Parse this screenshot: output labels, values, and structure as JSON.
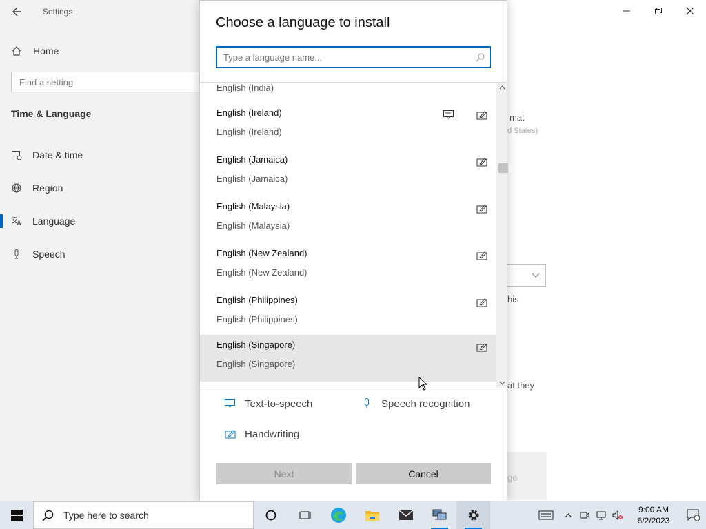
{
  "settings": {
    "app_title": "Settings",
    "home_label": "Home",
    "find_placeholder": "Find a setting",
    "section_title": "Time & Language",
    "nav": [
      {
        "label": "Date & time",
        "icon": "calendar-clock-icon"
      },
      {
        "label": "Region",
        "icon": "globe-icon"
      },
      {
        "label": "Language",
        "icon": "language-icon"
      },
      {
        "label": "Speech",
        "icon": "microphone-icon"
      }
    ],
    "active_nav": "Language",
    "background_fragments": {
      "format": "mat",
      "united_states": "d States)",
      "this": "his",
      "that_they": "at they",
      "ge": "ge"
    }
  },
  "dialog": {
    "title": "Choose a language to install",
    "search_placeholder": "Type a language name...",
    "partial_item": "English (India)",
    "languages": [
      {
        "name": "English (Ireland)",
        "native": "English (Ireland)",
        "tts": true,
        "handwriting": true,
        "selected": false
      },
      {
        "name": "English (Jamaica)",
        "native": "English (Jamaica)",
        "tts": false,
        "handwriting": true,
        "selected": false
      },
      {
        "name": "English (Malaysia)",
        "native": "English (Malaysia)",
        "tts": false,
        "handwriting": true,
        "selected": false
      },
      {
        "name": "English (New Zealand)",
        "native": "English (New Zealand)",
        "tts": false,
        "handwriting": true,
        "selected": false
      },
      {
        "name": "English (Philippines)",
        "native": "English (Philippines)",
        "tts": false,
        "handwriting": true,
        "selected": false
      },
      {
        "name": "English (Singapore)",
        "native": "English (Singapore)",
        "tts": false,
        "handwriting": true,
        "selected": true
      }
    ],
    "legend": {
      "tts": "Text-to-speech",
      "speech": "Speech recognition",
      "handwriting": "Handwriting"
    },
    "next_label": "Next",
    "cancel_label": "Cancel"
  },
  "taskbar": {
    "search_placeholder": "Type here to search",
    "time": "9:00 AM",
    "date": "6/2/2023"
  },
  "colors": {
    "accent": "#0067c0",
    "selected_row": "#e6e6e6",
    "button_bg": "#cccccc"
  }
}
